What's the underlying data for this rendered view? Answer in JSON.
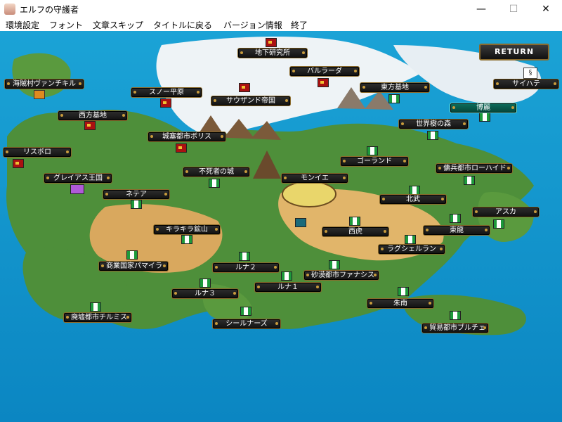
{
  "window": {
    "title": "エルフの守護者",
    "minimize": "—",
    "maximize": "☐",
    "close": "✕"
  },
  "menu": [
    "環境設定",
    "フォント",
    "文章スキップ",
    "タイトルに戻る",
    "バージョン情報",
    "終了"
  ],
  "return_label": "RETURN",
  "locations": {
    "chika": "地下研究所",
    "barurada": "バルラーダ",
    "toho": "東方基地",
    "saihate": "サイハテ",
    "kaizoku": "海賊村ヴァンチキル",
    "snow": "スノー平原",
    "thousand": "サウザンド帝国",
    "hakurai": "博麗",
    "seiho": "西方基地",
    "sekaiju": "世界樹の森",
    "jousai": "城塞都市ボリス",
    "risubori": "リスボロ",
    "golland": "ゴーランド",
    "youhei": "傭兵都市ローハイド",
    "fushi": "不死者の城",
    "greias": "グレイアス王国",
    "moniye": "モンイエ",
    "netea": "ネテア",
    "hokubu": "北武",
    "asuka": "アスカ",
    "kirakira": "キラキラ鉱山",
    "seiko": "西虎",
    "touryu": "東龍",
    "raguseru": "ラグシェルラン",
    "shogyo": "商業国家パマイラ",
    "luna2": "ルナ２",
    "sabaku": "砂漠都市ファナシス",
    "luna1": "ルナ１",
    "luna3": "ルナ３",
    "shunan": "朱南",
    "haikyo": "廃墟都市チルミス",
    "sealnaz": "シールナーズ",
    "boeki": "貿易都市ブルチェ"
  }
}
